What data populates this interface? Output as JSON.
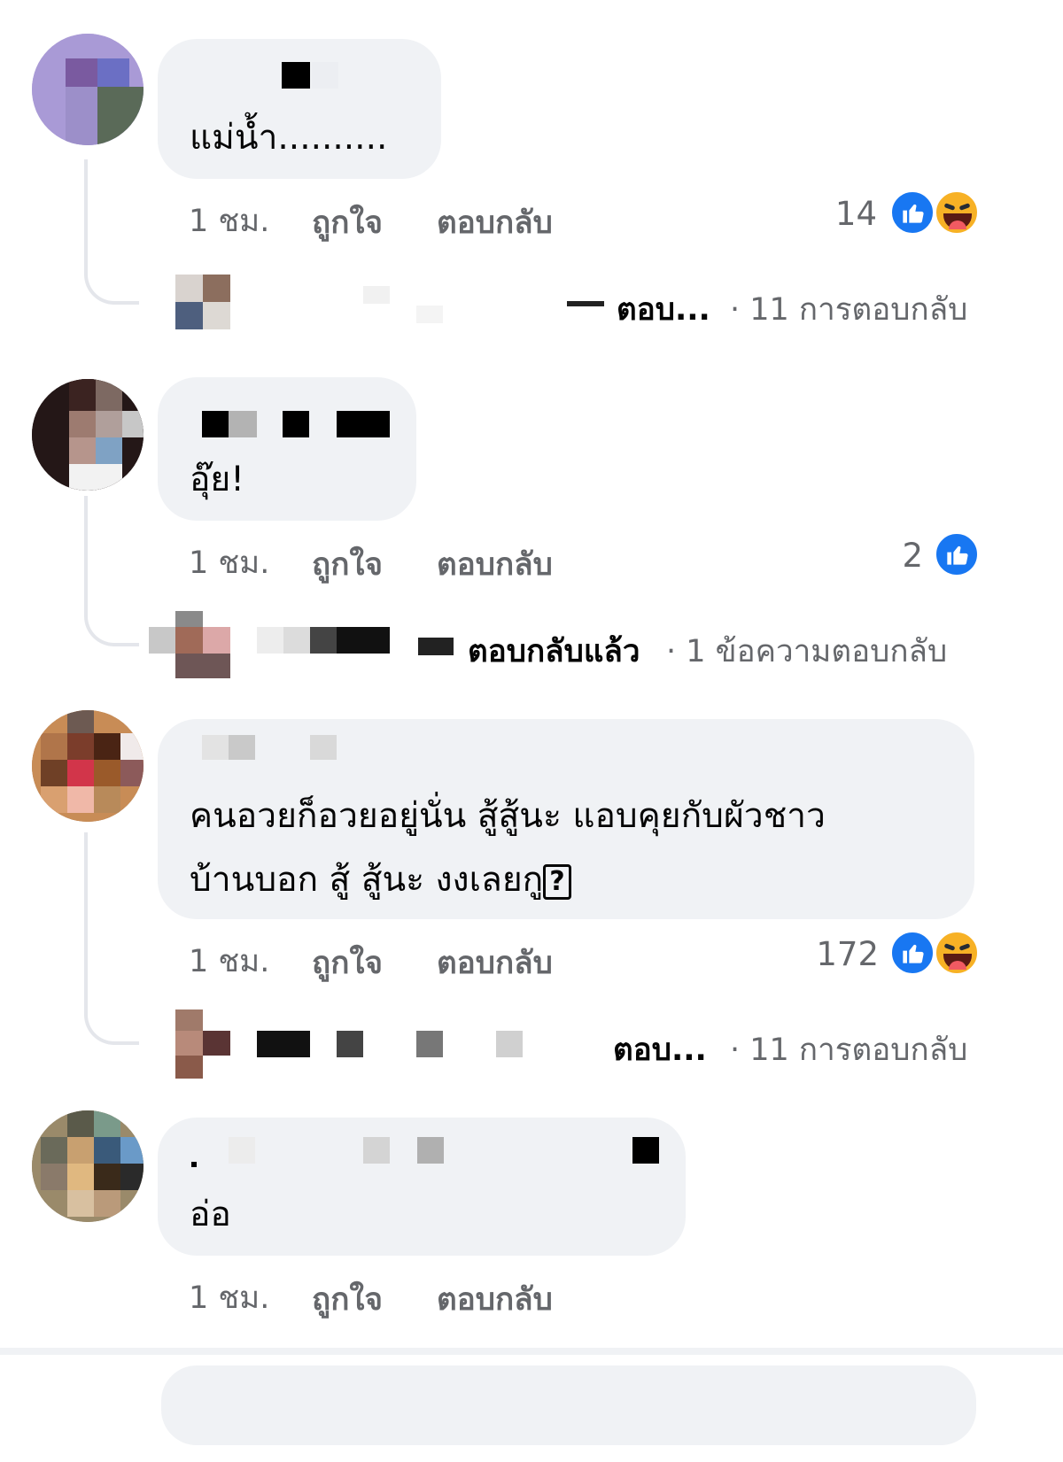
{
  "comments": [
    {
      "text": "แม่น้ำ..........",
      "time": "1 ชม.",
      "like_label": "ถูกใจ",
      "reply_label": "ตอบกลับ",
      "reaction_count": "14",
      "reactions": [
        "like-icon",
        "haha-icon"
      ],
      "replies": {
        "action": "ตอบ...",
        "count": "· 11 การตอบกลับ"
      }
    },
    {
      "text": "อุ๊ย!",
      "time": "1 ชม.",
      "like_label": "ถูกใจ",
      "reply_label": "ตอบกลับ",
      "reaction_count": "2",
      "reactions": [
        "like-icon"
      ],
      "replies": {
        "action": "ตอบกลับแล้ว",
        "count": "· 1 ข้อความตอบกลับ"
      }
    },
    {
      "text_line1": "คนอวยก็อวยอยู่นั่น สู้สู้นะ แอบคุยกับผัวชาว",
      "text_line2": "บ้านบอก สู้ สู้นะ งงเลยกู",
      "text_symbol": "?",
      "time": "1 ชม.",
      "like_label": "ถูกใจ",
      "reply_label": "ตอบกลับ",
      "reaction_count": "172",
      "reactions": [
        "like-icon",
        "haha-icon"
      ],
      "replies": {
        "action": "ตอบ...",
        "count": "· 11 การตอบกลับ"
      }
    },
    {
      "text": "อ่อ",
      "time": "1 ชม.",
      "like_label": "ถูกใจ",
      "reply_label": "ตอบกลับ",
      "reaction_count": "",
      "reactions": []
    }
  ],
  "colors": {
    "bubble": "#f0f2f5",
    "meta": "#65676b",
    "like_blue": "#1877f2",
    "haha_yellow": "#f7b125"
  }
}
